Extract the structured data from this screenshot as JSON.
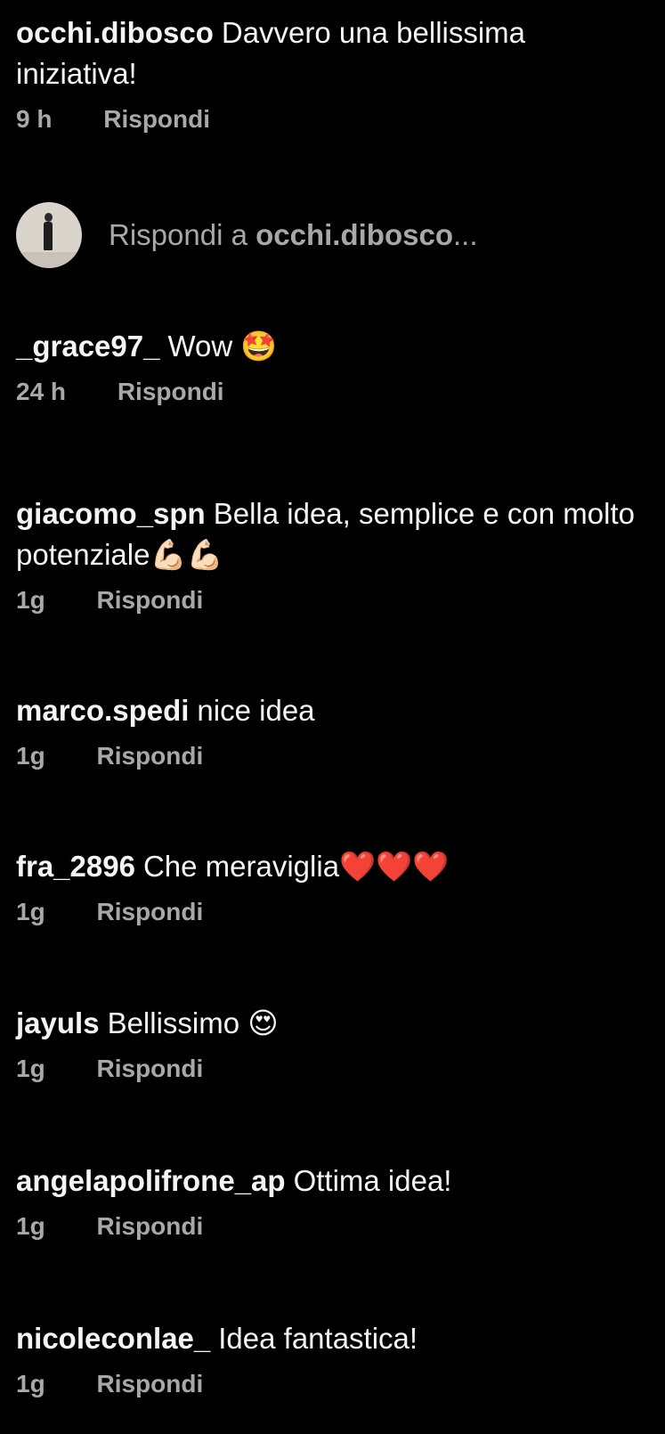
{
  "comments_before": [
    {
      "username": "occhi.dibosco",
      "text": "Davvero una bellissima iniziativa!",
      "time": "9 h",
      "reply_label": "Rispondi"
    }
  ],
  "reply_composer": {
    "prefix": "Rispondi a ",
    "target": "occhi.dibosco",
    "suffix": "..."
  },
  "comments": [
    {
      "username": "_grace97_",
      "text": "Wow ",
      "emoji": "🤩",
      "time": "24 h",
      "reply_label": "Rispondi"
    },
    {
      "username": "giacomo_spn",
      "text": "Bella idea, semplice e con molto potenziale",
      "emoji": "💪🏻💪🏻",
      "time": "1g",
      "reply_label": "Rispondi"
    },
    {
      "username": "marco.spedi",
      "text": "nice idea",
      "emoji": "",
      "time": "1g",
      "reply_label": "Rispondi"
    },
    {
      "username": "fra_2896",
      "text": "Che meraviglia",
      "emoji": "❤️❤️❤️",
      "time": "1g",
      "reply_label": "Rispondi"
    },
    {
      "username": "jayuls",
      "text": "Bellissimo ",
      "emoji": "😍",
      "time": "1g",
      "reply_label": "Rispondi"
    },
    {
      "username": "angelapolifrone_ap",
      "text": "Ottima idea!",
      "emoji": "",
      "time": "1g",
      "reply_label": "Rispondi"
    },
    {
      "username": "nicoleconlae_",
      "text": "Idea fantastica!",
      "emoji": "",
      "time": "1g",
      "reply_label": "Rispondi"
    }
  ],
  "colors": {
    "background": "#000000",
    "primary_text": "#f5f5f5",
    "secondary_text": "#a8a8a8"
  }
}
